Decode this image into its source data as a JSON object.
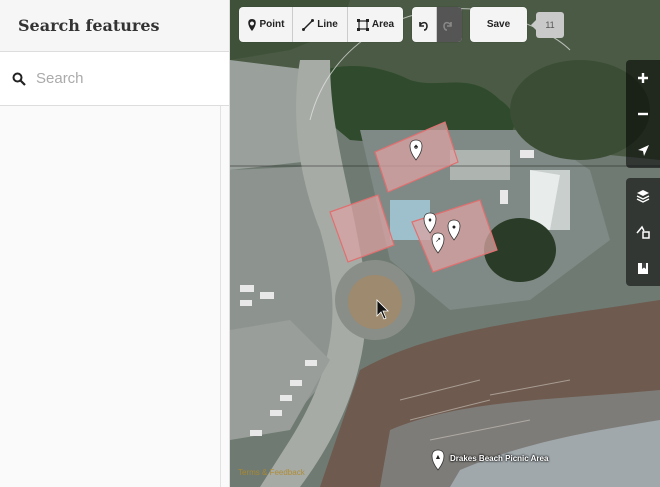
{
  "sidebar": {
    "title": "Search features",
    "search": {
      "placeholder": "Search",
      "value": ""
    }
  },
  "toolbar": {
    "point_label": "Point",
    "line_label": "Line",
    "area_label": "Area",
    "save_label": "Save",
    "edit_count": "11"
  },
  "map": {
    "poi_label": "Drakes Beach Picnic Area",
    "attribution": "Terms & Feedback"
  },
  "controls": {
    "zoom_in": "+",
    "zoom_out": "−"
  },
  "colors": {
    "area_fill": "#d9a3a3",
    "area_stroke": "#e07070",
    "toolbar_bg": "#f4f4f4"
  }
}
